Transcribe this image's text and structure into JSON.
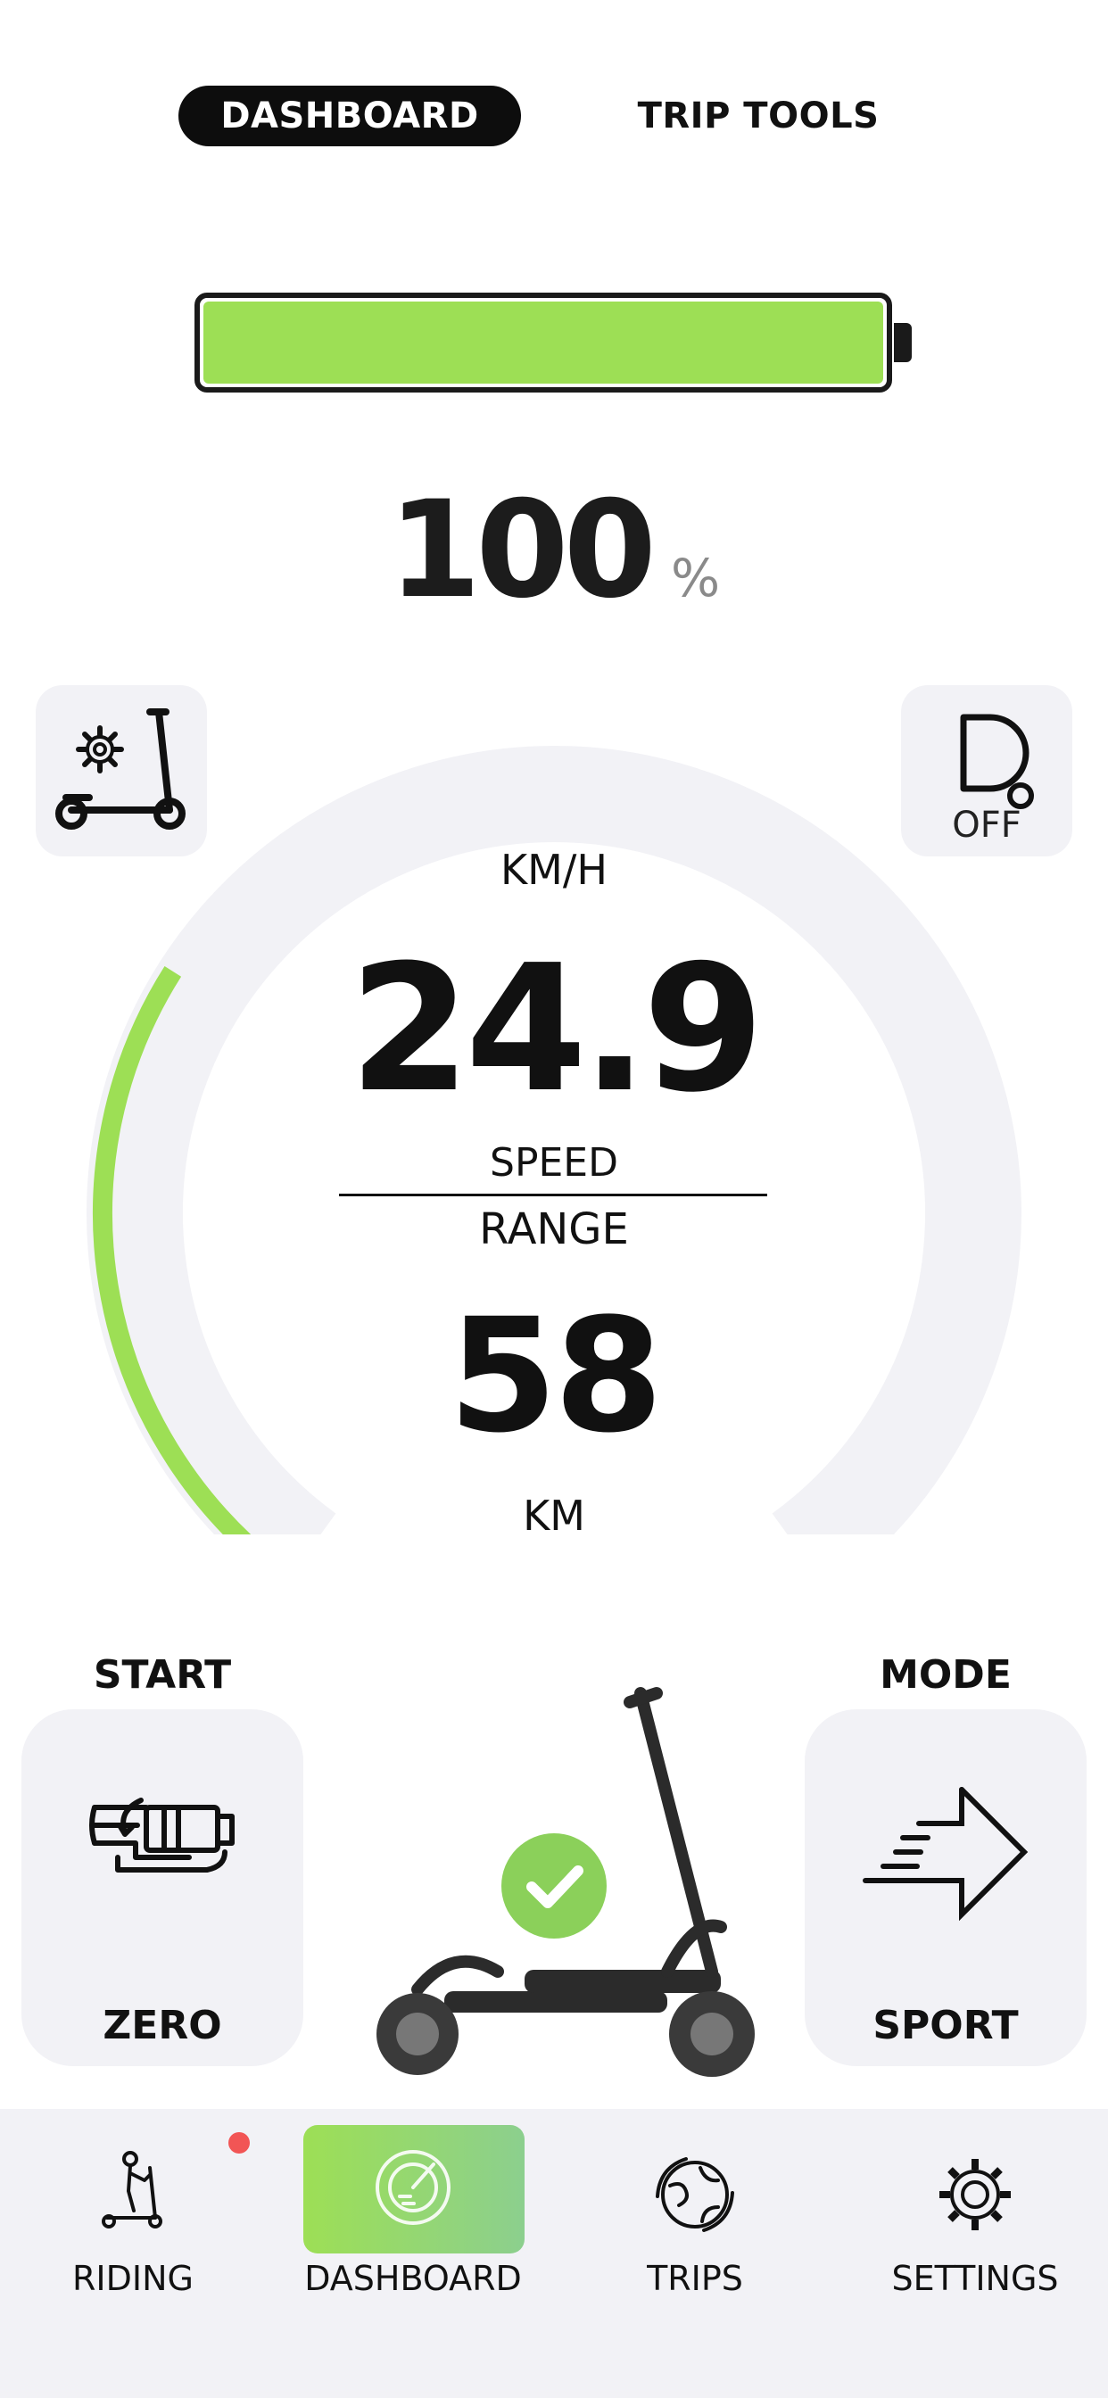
{
  "top_tabs": {
    "dashboard": "DASHBOARD",
    "trip_tools": "TRIP TOOLS",
    "active": "DASHBOARD"
  },
  "battery": {
    "level_fraction": 1.0,
    "percent": "100",
    "unit": "%",
    "color": "#9ddf55"
  },
  "light": {
    "state": "OFF",
    "icon": "headlight-icon"
  },
  "scooter_settings": {
    "icon": "scooter-settings-icon"
  },
  "gauge": {
    "speed_unit": "KM/H",
    "speed": "24.9",
    "speed_label": "SPEED",
    "range_label": "RANGE",
    "range": "58",
    "range_unit": "KM",
    "fill_fraction": 0.3,
    "fill_color": "#9ddf55",
    "track_color": "#f2f2f6"
  },
  "start": {
    "label": "START",
    "value": "ZERO",
    "icon": "throttle-icon"
  },
  "mode": {
    "label": "MODE",
    "value": "SPORT",
    "icon": "arrow-right-icon"
  },
  "status": {
    "connected": true,
    "icon": "check-icon"
  },
  "nav": {
    "items": [
      {
        "label": "RIDING",
        "icon": "rider-icon",
        "badge": true
      },
      {
        "label": "DASHBOARD",
        "icon": "speedometer-icon",
        "active": true
      },
      {
        "label": "TRIPS",
        "icon": "globe-icon"
      },
      {
        "label": "SETTINGS",
        "icon": "gear-icon"
      }
    ]
  }
}
